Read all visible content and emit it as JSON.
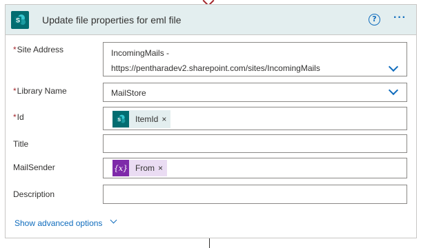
{
  "card": {
    "title": "Update file properties for eml file",
    "help_label": "?",
    "more_label": "···",
    "app_icon": "sharepoint-icon"
  },
  "fields": {
    "site_address": {
      "label": "Site Address",
      "required": "*",
      "value_line1": "IncomingMails -",
      "value_line2": "https://pentharadev2.sharepoint.com/sites/IncomingMails"
    },
    "library_name": {
      "label": "Library Name",
      "required": "*",
      "value": "MailStore"
    },
    "id": {
      "label": "Id",
      "required": "*",
      "token_label": "ItemId",
      "token_icon": "sharepoint-icon",
      "token_remove": "×"
    },
    "title": {
      "label": "Title",
      "value": ""
    },
    "mail_sender": {
      "label": "MailSender",
      "token_label": "From",
      "token_icon": "expression-icon",
      "token_icon_text": "{x}",
      "token_remove": "×"
    },
    "description": {
      "label": "Description",
      "value": ""
    }
  },
  "footer": {
    "advanced_label": "Show advanced options"
  },
  "colors": {
    "header_bg": "#e3eeef",
    "sharepoint": "#036c70",
    "expression": "#7e2aa9",
    "link": "#0f6cbd",
    "required": "#a4262c"
  }
}
